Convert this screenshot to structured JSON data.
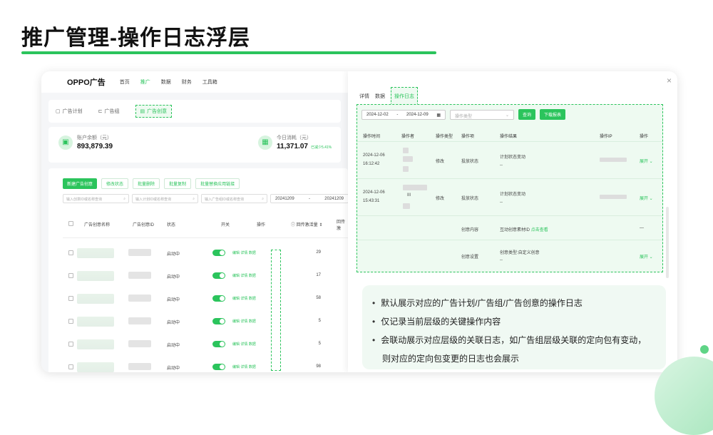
{
  "slide": {
    "title": "推广管理-操作日志浮层"
  },
  "app": {
    "logo": "OPPO广告",
    "nav": [
      "首页",
      "推广",
      "数据",
      "财务",
      "工具箱"
    ],
    "tabs": [
      "广告计划",
      "广告组",
      "广告创意"
    ],
    "stats": {
      "balance_label": "账户余额（元）",
      "balance_value": "893,879.39",
      "today_label": "今日消耗（元）",
      "today_value": "11,371.07",
      "today_delta": "已减少5.41%"
    },
    "buttons": [
      "新建广告创意",
      "修改状态",
      "批量删除",
      "批量复制",
      "批量替换应用链接"
    ],
    "search": [
      "输入创意ID或名称查询",
      "输入计划ID或名称查询",
      "输入广告组ID或名称查询"
    ],
    "date_from": "20241209",
    "date_to": "20241209",
    "headers": [
      "广告创意名称",
      "广告创意ID",
      "状态",
      "开关",
      "操作",
      "回传激活量",
      "回传激"
    ],
    "rows": [
      {
        "status": "启动中",
        "ops": "编辑 详情 数据",
        "value": "29"
      },
      {
        "status": "启动中",
        "ops": "编辑 详情 数据",
        "value": "17"
      },
      {
        "status": "启动中",
        "ops": "编辑 详情 数据",
        "value": "58"
      },
      {
        "status": "启动中",
        "ops": "编辑 详情 数据",
        "value": "5"
      },
      {
        "status": "启动中",
        "ops": "编辑 详情 数据",
        "value": "5"
      },
      {
        "status": "启动中",
        "ops": "编辑 详情 数据",
        "value": "98"
      }
    ]
  },
  "panel": {
    "tabs": [
      "详情",
      "数据",
      "操作日志"
    ],
    "date_from": "2024-12-02",
    "date_to": "2024-12-09",
    "type_placeholder": "操作类型",
    "query_button": "查询",
    "download_button": "下载报表",
    "headers": [
      "操作时间",
      "操作者",
      "操作类型",
      "操作项",
      "操作结果",
      "操作IP",
      "操作"
    ],
    "logs": [
      {
        "date": "2024-12-06",
        "time": "16:12:42",
        "type": "修改",
        "item": "投放状态",
        "result": "计划状态变动",
        "result2": "--",
        "action": "展开"
      },
      {
        "date": "2024-12-06",
        "time": "15:43:31",
        "op_mid": "III",
        "type": "修改",
        "item": "投放状态",
        "result": "计划状态变动",
        "result2": "--",
        "action": "展开"
      }
    ],
    "sub1": {
      "item": "创意内容",
      "result_prefix": "互动创意素材ID",
      "result_link": "点击查看",
      "action": "—"
    },
    "sub2": {
      "item": "创意设置",
      "result": "创意类型:自定义创意",
      "result2": "--",
      "action": "展开"
    }
  },
  "bullets": [
    "默认展示对应的广告计划/广告组/广告创意的操作日志",
    "仅记录当前层级的关键操作内容",
    "会联动展示对应层级的关联日志，如广告组层级关联的定向包有变动，",
    "则对应的定向包变更的日志也会展示"
  ]
}
